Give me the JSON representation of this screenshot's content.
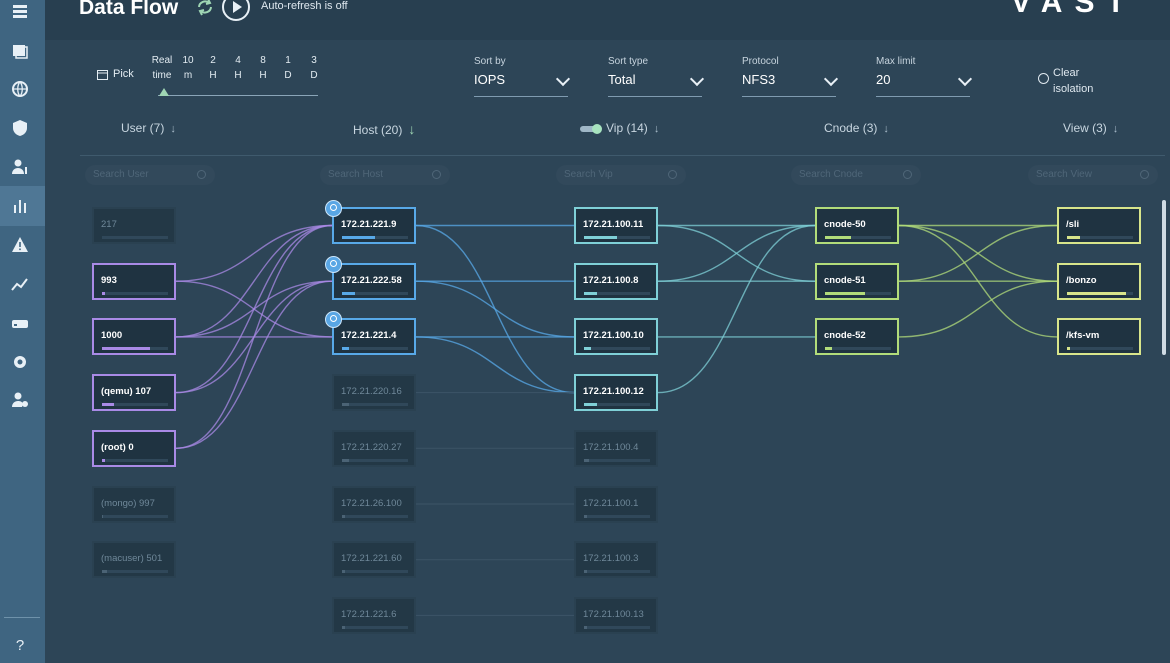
{
  "app": {
    "title": "Data Flow",
    "auto_refresh": "Auto-refresh is off",
    "logo": "VAST"
  },
  "sidebar": {
    "icons": [
      "dashboard-icon",
      "folder-icon",
      "globe-icon",
      "shield-icon",
      "users-icon",
      "analytics-icon",
      "alert-icon",
      "trend-icon",
      "server-icon",
      "settings-icon",
      "user-settings-icon"
    ],
    "help": "?"
  },
  "toolbar": {
    "pick": "Pick",
    "time_ranges": [
      [
        "Real",
        "time"
      ],
      [
        "10",
        "m"
      ],
      [
        "2",
        "H"
      ],
      [
        "4",
        "H"
      ],
      [
        "8",
        "H"
      ],
      [
        "1",
        "D"
      ],
      [
        "3",
        "D"
      ]
    ],
    "sort_by": {
      "label": "Sort by",
      "value": "IOPS"
    },
    "sort_type": {
      "label": "Sort type",
      "value": "Total"
    },
    "protocol": {
      "label": "Protocol",
      "value": "NFS3"
    },
    "max_limit": {
      "label": "Max limit",
      "value": "20"
    },
    "clear_isolation": [
      "Clear",
      "isolation"
    ]
  },
  "columns": [
    {
      "label": "User (7)",
      "search": "Search User",
      "arrow": "↓"
    },
    {
      "label": "Host (20)",
      "search": "Search Host",
      "arrow": "↓"
    },
    {
      "label": "Vip (14)",
      "search": "Search Vip",
      "arrow": "↓"
    },
    {
      "label": "Cnode (3)",
      "search": "Search Cnode",
      "arrow": "↓"
    },
    {
      "label": "View (3)",
      "search": "Search View",
      "arrow": "↓"
    }
  ],
  "nodes": {
    "user": [
      {
        "label": "217",
        "active": false,
        "load": 0
      },
      {
        "label": "993",
        "active": true,
        "load": 0.05
      },
      {
        "label": "1000",
        "active": true,
        "load": 0.72
      },
      {
        "label": "(qemu) 107",
        "active": true,
        "load": 0.18
      },
      {
        "label": "(root) 0",
        "active": true,
        "load": 0.04
      },
      {
        "label": "(mongo) 997",
        "active": false,
        "load": 0.02
      },
      {
        "label": "(macuser) 501",
        "active": false,
        "load": 0.08
      }
    ],
    "host": [
      {
        "label": "172.21.221.9",
        "active": true,
        "load": 0.5,
        "isolated": true
      },
      {
        "label": "172.21.222.58",
        "active": true,
        "load": 0.2,
        "isolated": true
      },
      {
        "label": "172.21.221.4",
        "active": true,
        "load": 0.1,
        "isolated": true
      },
      {
        "label": "172.21.220.16",
        "active": false,
        "load": 0.1,
        "isolated": false
      },
      {
        "label": "172.21.220.27",
        "active": false,
        "load": 0.1,
        "isolated": false
      },
      {
        "label": "172.21.26.100",
        "active": false,
        "load": 0.05,
        "isolated": false
      },
      {
        "label": "172.21.221.60",
        "active": false,
        "load": 0.05,
        "isolated": false
      },
      {
        "label": "172.21.221.6",
        "active": false,
        "load": 0.05,
        "isolated": false
      }
    ],
    "vip": [
      {
        "label": "172.21.100.11",
        "active": true,
        "load": 0.5
      },
      {
        "label": "172.21.100.8",
        "active": true,
        "load": 0.2
      },
      {
        "label": "172.21.100.10",
        "active": true,
        "load": 0.1
      },
      {
        "label": "172.21.100.12",
        "active": true,
        "load": 0.2
      },
      {
        "label": "172.21.100.4",
        "active": false,
        "load": 0.08
      },
      {
        "label": "172.21.100.1",
        "active": false,
        "load": 0.05
      },
      {
        "label": "172.21.100.3",
        "active": false,
        "load": 0.05
      },
      {
        "label": "172.21.100.13",
        "active": false,
        "load": 0.05
      }
    ],
    "cnode": [
      {
        "label": "cnode-50",
        "active": true,
        "load": 0.4
      },
      {
        "label": "cnode-51",
        "active": true,
        "load": 0.6
      },
      {
        "label": "cnode-52",
        "active": true,
        "load": 0.1
      }
    ],
    "view": [
      {
        "label": "/sli",
        "active": true,
        "load": 0.2
      },
      {
        "label": "/bonzo",
        "active": true,
        "load": 0.9
      },
      {
        "label": "/kfs-vm",
        "active": true,
        "load": 0.05
      }
    ]
  },
  "links": {
    "user_host": [
      [
        1,
        0
      ],
      [
        1,
        2
      ],
      [
        2,
        0
      ],
      [
        2,
        1
      ],
      [
        2,
        2
      ],
      [
        3,
        0
      ],
      [
        3,
        1
      ],
      [
        4,
        0
      ],
      [
        4,
        1
      ]
    ],
    "host_vip": [
      [
        0,
        0
      ],
      [
        0,
        3
      ],
      [
        1,
        1
      ],
      [
        1,
        2
      ],
      [
        2,
        2
      ],
      [
        2,
        3
      ]
    ],
    "vip_cnode": [
      [
        0,
        0
      ],
      [
        0,
        1
      ],
      [
        1,
        0
      ],
      [
        1,
        1
      ],
      [
        2,
        2
      ],
      [
        3,
        0
      ]
    ],
    "cnode_view": [
      [
        0,
        0
      ],
      [
        0,
        1
      ],
      [
        0,
        2
      ],
      [
        1,
        0
      ],
      [
        1,
        1
      ],
      [
        2,
        1
      ]
    ]
  },
  "colors": {
    "user": "#a98ae6",
    "host": "#58a9e8",
    "vip": "#7fd0d7",
    "cnode": "#b2dc7a",
    "view": "#d8e58b"
  }
}
